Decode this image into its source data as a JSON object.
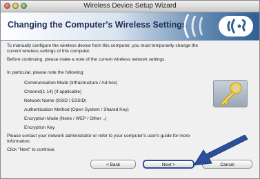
{
  "window": {
    "title": "Wireless Device Setup Wizard"
  },
  "header": {
    "title": "Changing the Computer's Wireless Settings"
  },
  "body": {
    "intro_line1": "To manually configure the wireless device from this computer, you must temporarily change the",
    "intro_line2": "current wireless settings of this computer.",
    "note_before": "Before continuing, please make a note of the current wireless network settings.",
    "in_particular": "In particular, please note the following:",
    "items": [
      "Communication Mode (Infrastructure / Ad-hoc)",
      "Channel(1-14) (if applicable)",
      "Network Name (SSID / ESSID)",
      "Authentication Method (Open System / Shared Key)",
      "Encryption Mode (None / WEP / Other ..)",
      "Encryption Key"
    ],
    "contact_line1": "Please contact your network administrator or refer to your computer's user's guide for more",
    "contact_line2": "information.",
    "click_next": "Click \"Next\" to continue."
  },
  "buttons": {
    "back": "< Back",
    "next": "Next >",
    "cancel": "Cancel"
  },
  "icons": {
    "key": "key-icon",
    "wifi": "wifi-logo-icon",
    "arrow": "pointer-arrow-icon"
  },
  "colors": {
    "header_title": "#1f2f5a",
    "arrow": "#2b4f9a"
  }
}
